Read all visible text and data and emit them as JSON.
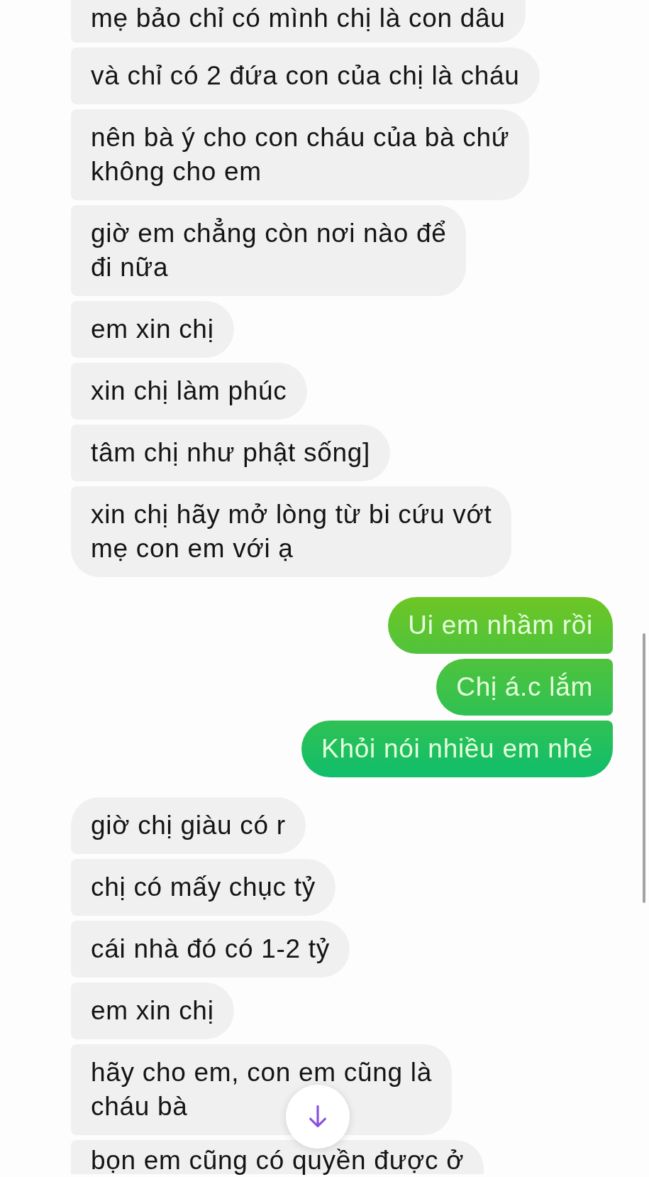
{
  "conversation": {
    "messages": [
      {
        "kind": "incoming",
        "text": "mẹ bảo chỉ có mình chị là con dâu"
      },
      {
        "kind": "incoming",
        "text": "và chỉ có 2 đứa con của chị là cháu"
      },
      {
        "kind": "incoming",
        "text": "nên bà ý cho con cháu của bà chứ\nkhông cho em"
      },
      {
        "kind": "incoming",
        "text": "giờ em chẳng còn nơi nào để\nđi nữa"
      },
      {
        "kind": "incoming",
        "text": "em xin chị"
      },
      {
        "kind": "incoming",
        "text": "xin chị làm phúc"
      },
      {
        "kind": "incoming",
        "text": "tâm chị như phật sống]"
      },
      {
        "kind": "incoming",
        "text": "xin chị hãy mở lòng từ bi cứu vớt\nmẹ con em với ạ"
      },
      {
        "kind": "outgoing",
        "text": "Ui em nhầm rồi"
      },
      {
        "kind": "outgoing",
        "text": "Chị á.c lắm"
      },
      {
        "kind": "outgoing",
        "text": "Khỏi nói nhiều em nhé"
      },
      {
        "kind": "incoming",
        "text": "giờ chị giàu có r"
      },
      {
        "kind": "incoming",
        "text": "chị có mấy chục tỷ"
      },
      {
        "kind": "incoming",
        "text": "cái nhà đó có 1-2 tỷ"
      },
      {
        "kind": "incoming",
        "text": "em xin chị"
      },
      {
        "kind": "incoming",
        "text": "hãy cho em, con em cũng là\ncháu bà"
      },
      {
        "kind": "incoming",
        "text": "bọn em cũng có quyền được ở"
      }
    ]
  }
}
